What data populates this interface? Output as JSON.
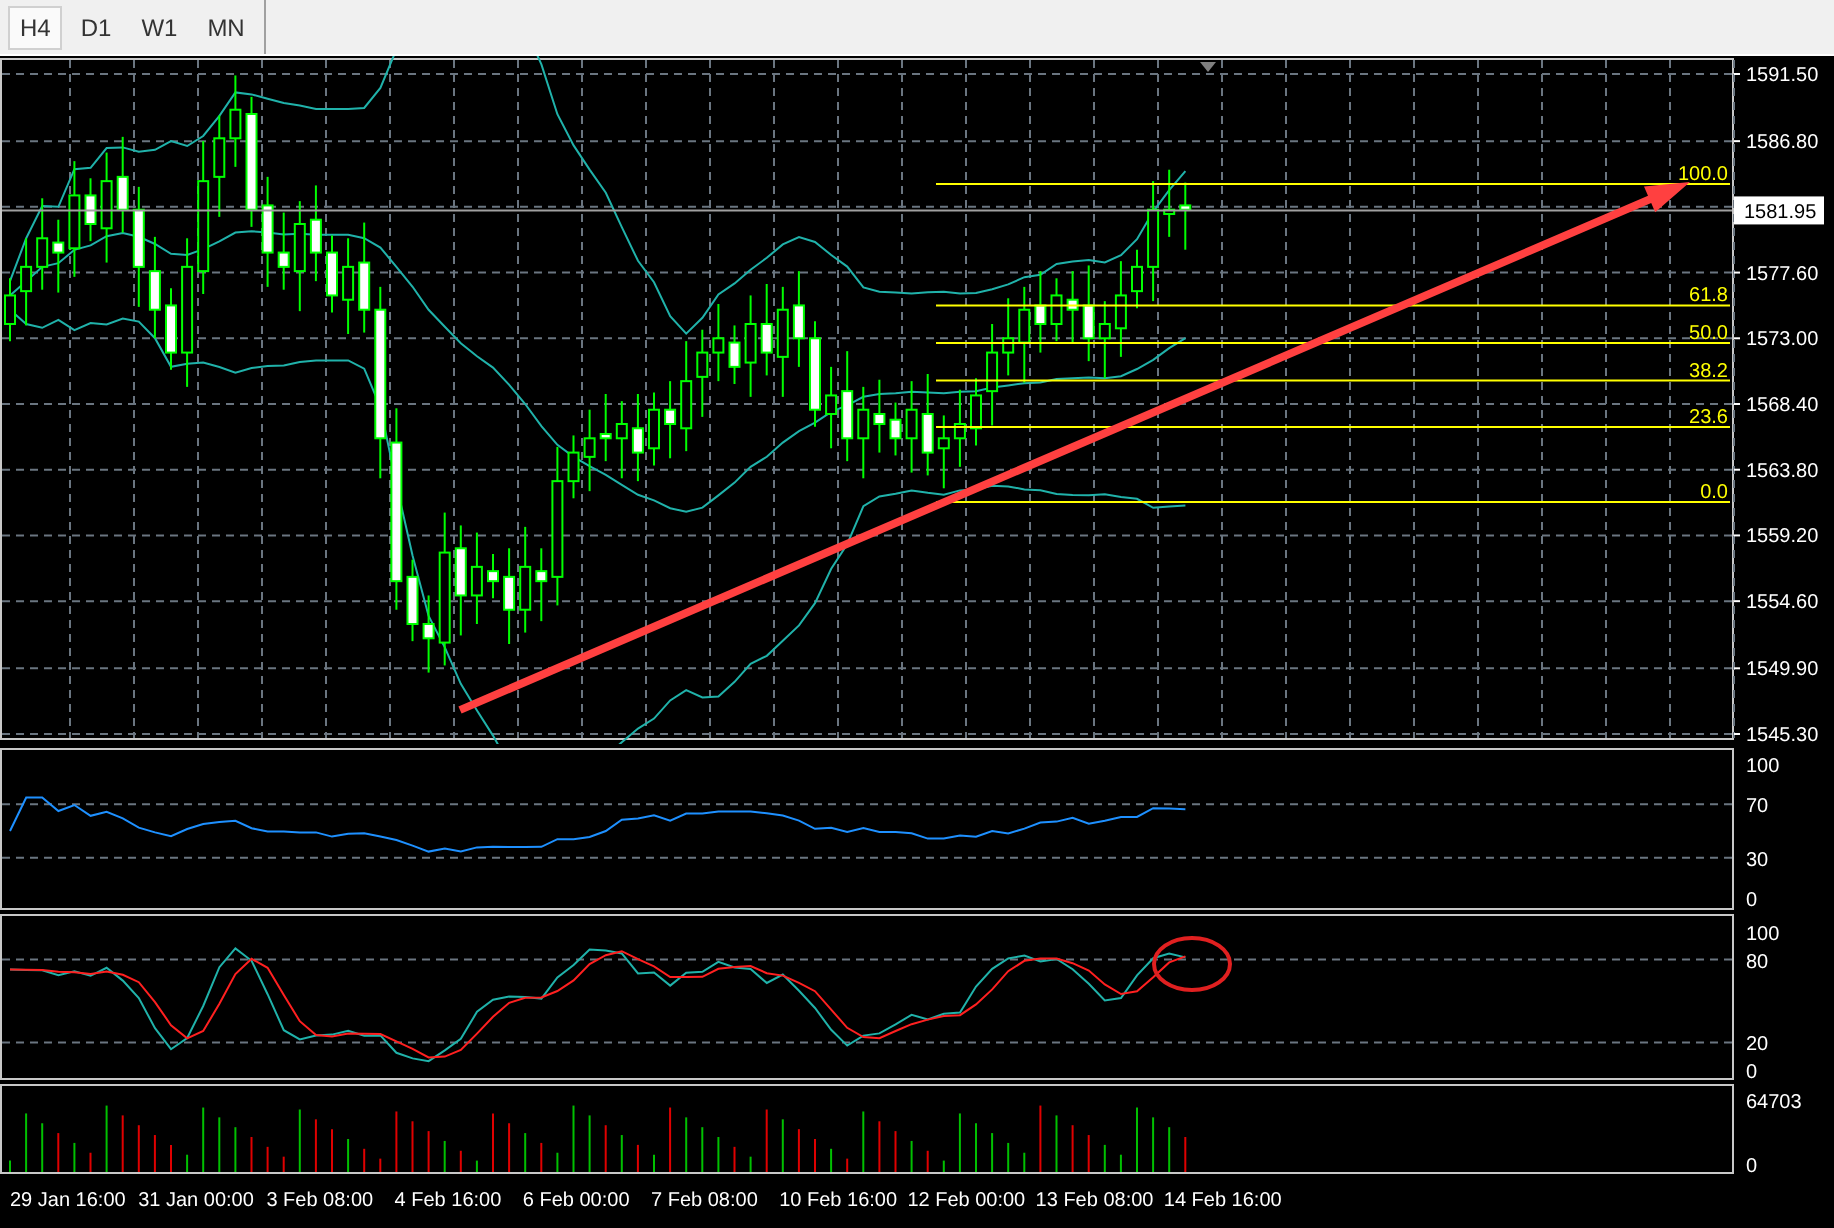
{
  "tabs": [
    {
      "label": "H4",
      "selected": true
    },
    {
      "label": "D1",
      "selected": false
    },
    {
      "label": "W1",
      "selected": false
    },
    {
      "label": "MN",
      "selected": false
    }
  ],
  "main": {
    "price_ticks": [
      "1591.50",
      "1586.80",
      "1577.60",
      "1573.00",
      "1568.40",
      "1563.80",
      "1559.20",
      "1554.60",
      "1549.90",
      "1545.30"
    ],
    "current_price": "1581.95",
    "fib_levels": [
      "100.0",
      "61.8",
      "50.0",
      "38.2",
      "23.6",
      "0.0"
    ]
  },
  "rsi": {
    "ticks": [
      "100",
      "70",
      "30",
      "0"
    ]
  },
  "stochastic": {
    "ticks": [
      "100",
      "80",
      "20",
      "0"
    ]
  },
  "volume": {
    "ticks": [
      "64703",
      "0"
    ]
  },
  "time_axis": [
    "29 Jan 16:00",
    "31 Jan 00:00",
    "3 Feb 08:00",
    "4 Feb 16:00",
    "6 Feb 00:00",
    "7 Feb 08:00",
    "10 Feb 16:00",
    "12 Feb 00:00",
    "13 Feb 08:00",
    "14 Feb 16:00"
  ]
}
